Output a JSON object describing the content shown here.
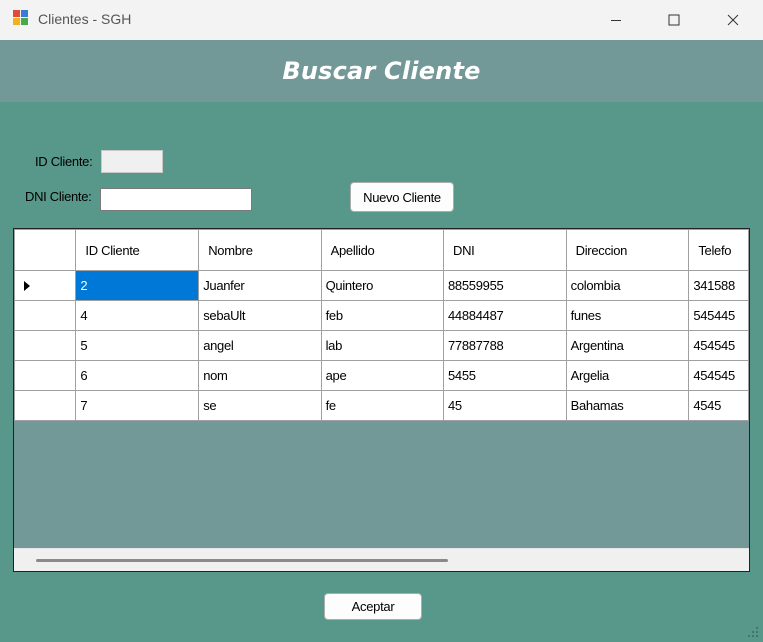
{
  "window": {
    "title": "Clientes - SGH"
  },
  "header": {
    "title": "Buscar Cliente"
  },
  "filters": {
    "id_label": "ID Cliente:",
    "id_value": "",
    "dni_label": "DNI Cliente:",
    "dni_value": ""
  },
  "buttons": {
    "nuevo": "Nuevo Cliente",
    "aceptar": "Aceptar"
  },
  "grid": {
    "columns": [
      "ID Cliente",
      "Nombre",
      "Apellido",
      "DNI",
      "Direccion",
      "Telefo"
    ],
    "rows": [
      [
        "2",
        "Juanfer",
        "Quintero",
        "88559955",
        "colombia",
        "341588"
      ],
      [
        "4",
        "sebaUlt",
        "feb",
        "44884487",
        "funes",
        "545445"
      ],
      [
        "5",
        "angel",
        "lab",
        "77887788",
        "Argentina",
        "454545"
      ],
      [
        "6",
        "nom",
        "ape",
        "5455",
        "Argelia",
        "454545"
      ],
      [
        "7",
        "se",
        "fe",
        "45",
        "Bahamas",
        "4545"
      ]
    ]
  },
  "colors": {
    "form_bg": "#58988a",
    "header_bg": "#729998",
    "selection": "#0078d7"
  }
}
